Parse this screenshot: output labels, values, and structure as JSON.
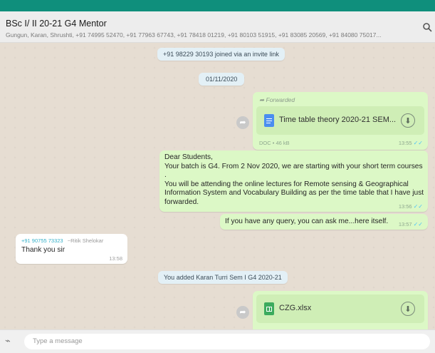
{
  "header": {
    "title": "BSc I/ II 20-21 G4 Mentor",
    "members": "Gungun, Karan, Shrushti, +91 74995 52470, +91 77963 67743, +91 78418 01219, +91 80103 51915, +91 83085 20569, +91 84080 75017..."
  },
  "chat": {
    "joined_notice": "+91 98229 30193 joined via an invite link",
    "date_chip": "01/11/2020",
    "forwarded_doc": {
      "forwarded_label": "Forwarded",
      "file_name": "Time table theory 2020-21 SEM...",
      "file_meta": "DOC • 46 kB",
      "time": "13:55"
    },
    "message_1": {
      "greeting": "Dear Students,",
      "line_2": "Your batch is G4. From 2 Nov 2020, we are starting with your short term courses",
      "line_3": ".",
      "body": "You will be attending the online lectures for Remote sensing & Geographical Information System and Vocabulary Building as per the time table that I have just forwarded.",
      "time": "13:56"
    },
    "message_2": {
      "text": "If you have any query, you can ask me...here itself.",
      "time": "13:57"
    },
    "reply": {
      "sender_phone": "+91 90755 73323",
      "sender_name": "~Ritik Shelokar",
      "text": "Thank you sir",
      "time": "13:58"
    },
    "added_notice": "You added Karan Turri Sem I G4 2020-21",
    "xlsx_doc": {
      "file_name": "CZG.xlsx"
    }
  },
  "composer": {
    "placeholder": "Type a message"
  },
  "colors": {
    "accent": "#0f8f7c",
    "outgoing_bubble": "#dcf8c6",
    "incoming_bubble": "#ffffff",
    "system_chip": "#e3f0f6",
    "read_ticks": "#4fc3f7",
    "sender_name": "#35b0c9"
  }
}
